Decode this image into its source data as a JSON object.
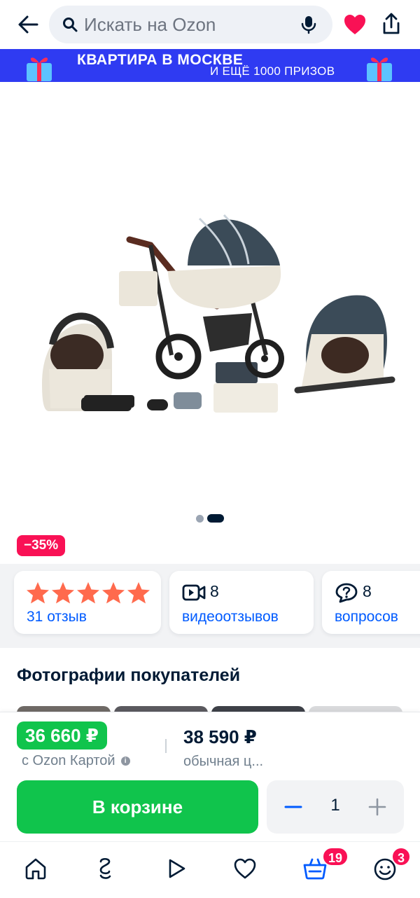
{
  "search": {
    "placeholder": "Искать на Ozon"
  },
  "banner": {
    "line1": "КВАРТИРА В МОСКВЕ",
    "line2": "И ЕЩЁ 1000 ПРИЗОВ",
    "background": "#2f3bf2"
  },
  "product": {
    "image_alt": "product-image-stroller-3in1",
    "gallery_current": 2,
    "gallery_total": 2,
    "discount": "−35%"
  },
  "cards": {
    "rating_stars": 5,
    "reviews_link": "31 отзыв",
    "video_count": "8",
    "video_link": "видеоотзывов",
    "questions_count": "8",
    "questions_link": "вопросов"
  },
  "photos": {
    "title": "Фотографии покупателей"
  },
  "price": {
    "ozon_card_price": "36 660 ₽",
    "ozon_card_label": "с Ozon Картой",
    "regular_price": "38 590 ₽",
    "regular_label": "обычная ц..."
  },
  "cart": {
    "button_label": "В корзине",
    "quantity": "1"
  },
  "nav": {
    "items": [
      "home-icon",
      "fresh-icon",
      "video-icon",
      "favorites-icon",
      "cart-icon",
      "profile-icon"
    ],
    "cart_badge": "19",
    "profile_badge": "3"
  },
  "colors": {
    "accent_blue": "#005bff",
    "green": "#10c44c",
    "red_badge": "#f91155",
    "star": "#ff6a4d"
  }
}
